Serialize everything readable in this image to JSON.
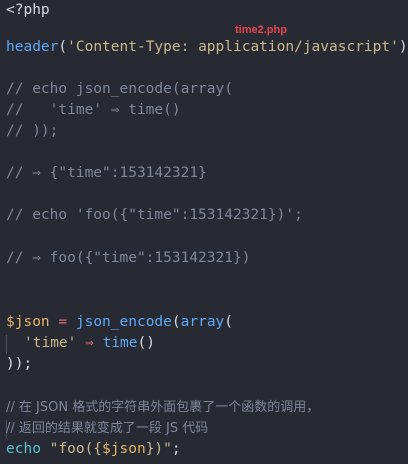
{
  "filename": "time2.php",
  "lines": {
    "l1": "<?php",
    "l2": {
      "fn": "header",
      "open": "(",
      "str": "'Content-Type: application/javascript'",
      "close": ");"
    },
    "l3": "// echo json_encode(array(",
    "l4": "//   'time' ⇒ time()",
    "l5": "// ));",
    "l6": "// ⇒ {\"time\":153142321}",
    "l7": "// echo 'foo({\"time\":153142321})';",
    "l8": "// ⇒ foo({\"time\":153142321})",
    "l9": {
      "var": "$json",
      "eq": " = ",
      "fn1": "json_encode",
      "p1": "(",
      "fn2": "array",
      "p2": "("
    },
    "l10": {
      "str": "'time'",
      "arrow": "⇒",
      "fn": "time",
      "parens": "()"
    },
    "l11": "));",
    "l12": "// 在 JSON 格式的字符串外面包裹了一个函数的调用，",
    "l13": "// 返回的结果就变成了一段 JS 代码",
    "l14": {
      "kw": "echo",
      "str1": "\"foo({",
      "var": "$json",
      "str2": "})\"",
      "semi": ";"
    }
  }
}
